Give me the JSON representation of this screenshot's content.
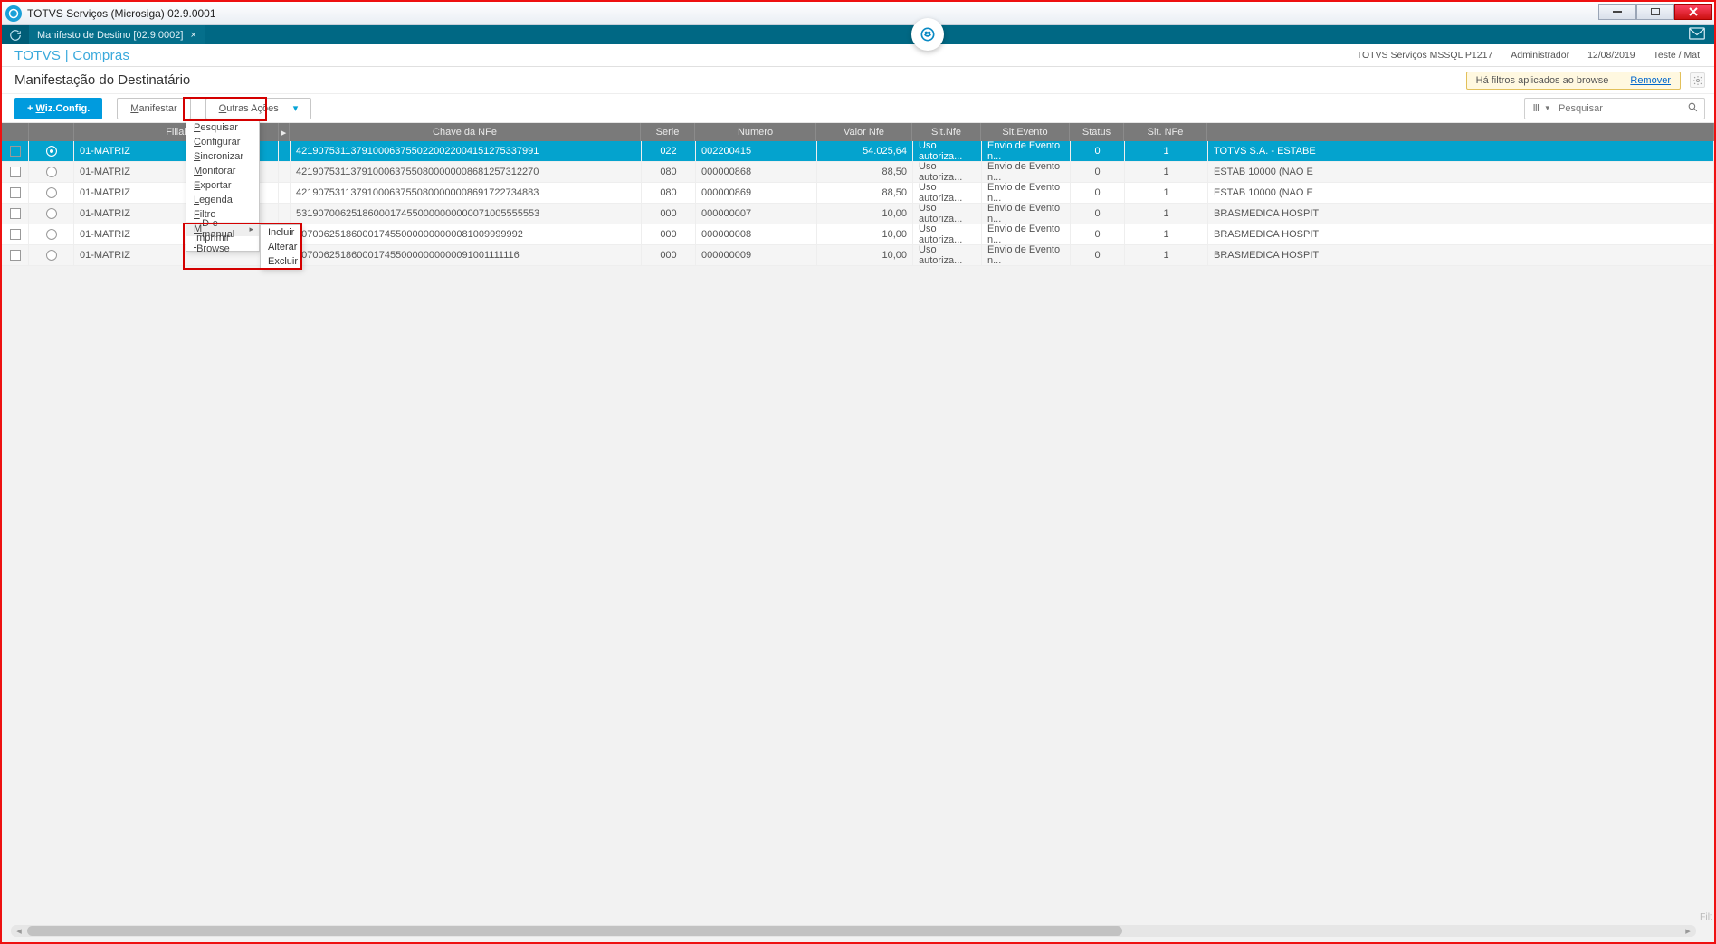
{
  "window": {
    "title": "TOTVS Serviços (Microsiga) 02.9.0001"
  },
  "tab": {
    "label": "Manifesto de Destino [02.9.0002]"
  },
  "module": "TOTVS | Compras",
  "meta": {
    "server": "TOTVS Serviços MSSQL P1217",
    "user": "Administrador",
    "date": "12/08/2019",
    "env": "Teste / Mat"
  },
  "routineTitle": "Manifestação do Destinatário",
  "filterBanner": {
    "text": "Há filtros aplicados ao browse",
    "link": "Remover"
  },
  "buttons": {
    "wiz": "+ Wiz.Config.",
    "manifestar": "Manifestar",
    "outras": "Outras Ações"
  },
  "search": {
    "placeholder": "Pesquisar"
  },
  "cols": {
    "filial": "Filial",
    "expand": "▸",
    "chave": "Chave da NFe",
    "serie": "Serie",
    "numero": "Numero",
    "valor": "Valor Nfe",
    "sitnfe": "Sit.Nfe",
    "sitev": "Sit.Evento",
    "status": "Status",
    "sit2": "Sit. NFe"
  },
  "rows": [
    {
      "selected": true,
      "filial": "01-MATRIZ",
      "chave": "42190753113791000637550220022004151275337991",
      "serie": "022",
      "numero": "002200415",
      "valor": "54.025,64",
      "sitnfe": "Uso autoriza...",
      "sitev": "Envio de Evento n...",
      "status": "0",
      "sit2": "1",
      "desc": "TOTVS S.A. - ESTABE"
    },
    {
      "selected": false,
      "filial": "01-MATRIZ",
      "chave": "42190753113791000637550800000008681257312270",
      "serie": "080",
      "numero": "000000868",
      "valor": "88,50",
      "sitnfe": "Uso autoriza...",
      "sitev": "Envio de Evento n...",
      "status": "0",
      "sit2": "1",
      "desc": "ESTAB 10000 (NAO E"
    },
    {
      "selected": false,
      "filial": "01-MATRIZ",
      "chave": "42190753113791000637550800000008691722734883",
      "serie": "080",
      "numero": "000000869",
      "valor": "88,50",
      "sitnfe": "Uso autoriza...",
      "sitev": "Envio de Evento n...",
      "status": "0",
      "sit2": "1",
      "desc": "ESTAB 10000 (NAO E"
    },
    {
      "selected": false,
      "filial": "01-MATRIZ",
      "chave": "53190700625186000174550000000000071005555553",
      "serie": "000",
      "numero": "000000007",
      "valor": "10,00",
      "sitnfe": "Uso autoriza...",
      "sitev": "Envio de Evento n...",
      "status": "0",
      "sit2": "1",
      "desc": "BRASMEDICA HOSPIT"
    },
    {
      "selected": false,
      "filial": "01-MATRIZ",
      "chave": "90700625186000174550000000000081009999992",
      "serie": "000",
      "numero": "000000008",
      "valor": "10,00",
      "sitnfe": "Uso autoriza...",
      "sitev": "Envio de Evento n...",
      "status": "0",
      "sit2": "1",
      "desc": "BRASMEDICA HOSPIT"
    },
    {
      "selected": false,
      "filial": "01-MATRIZ",
      "chave": "90700625186000174550000000000091001111116",
      "serie": "000",
      "numero": "000000009",
      "valor": "10,00",
      "sitnfe": "Uso autoriza...",
      "sitev": "Envio de Evento n...",
      "status": "0",
      "sit2": "1",
      "desc": "BRASMEDICA HOSPIT"
    }
  ],
  "menu": {
    "items": [
      "Pesquisar",
      "Configurar",
      "Sincronizar",
      "Monitorar",
      "Exportar",
      "Legenda",
      "Filtro",
      "MD-e manual",
      "Imprimir Browse"
    ],
    "submenuIndex": 7,
    "submenu": [
      "Incluir",
      "Alterar",
      "Excluir"
    ]
  },
  "filtLabel": "Filt"
}
